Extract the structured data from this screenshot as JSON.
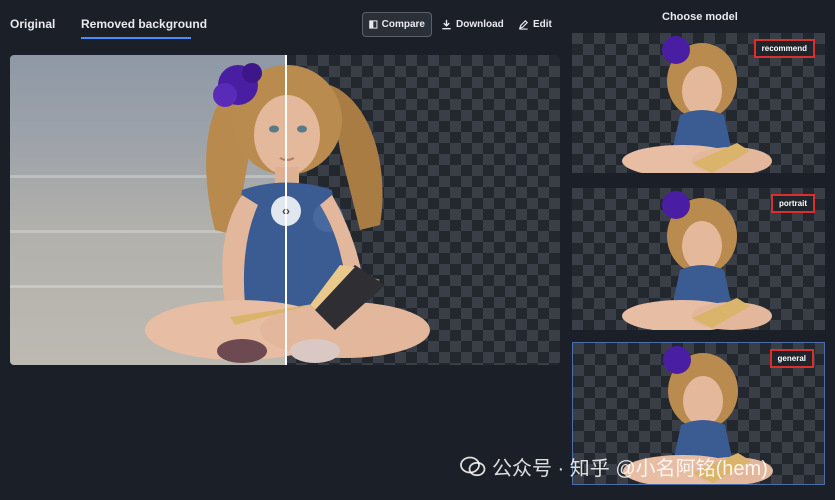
{
  "tabs": {
    "original": "Original",
    "removed": "Removed background"
  },
  "toolbar": {
    "compare": "Compare",
    "download": "Download",
    "edit": "Edit"
  },
  "models": {
    "title": "Choose model",
    "options": [
      {
        "label": "recommend"
      },
      {
        "label": "portrait"
      },
      {
        "label": "general"
      }
    ]
  },
  "watermark": {
    "text": "公众号 · 知乎 @小名阿铭(hem)",
    "logo_text": "知"
  },
  "colors": {
    "background": "#1b1f27",
    "accent": "#4a8cff",
    "highlight_box": "#d9302e"
  },
  "icons": {
    "compare": "compare-icon",
    "download": "download-icon",
    "edit": "edit-icon",
    "handle": "drag-handle-icon",
    "logo": "wechat-logo"
  }
}
